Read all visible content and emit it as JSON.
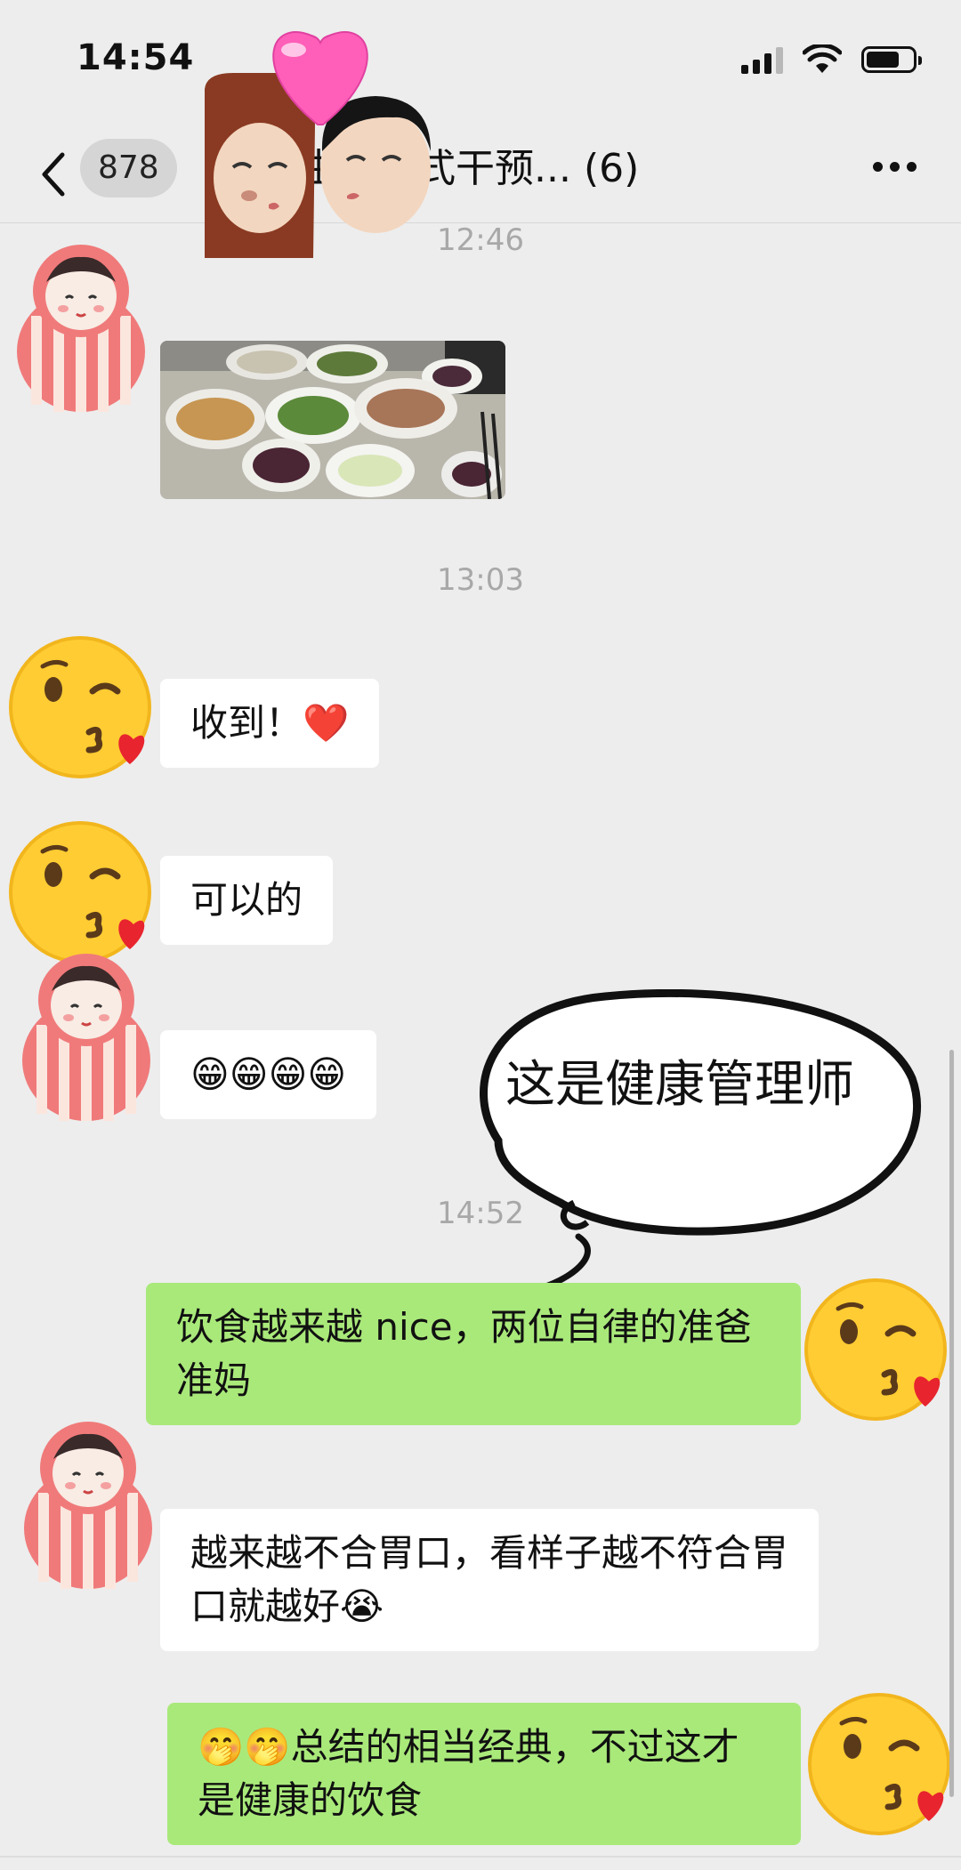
{
  "status_bar": {
    "time": "14:54"
  },
  "nav": {
    "unread_count": "878",
    "title": "生活方式干预... (6)"
  },
  "timestamps": [
    "12:46",
    "13:03",
    "14:52"
  ],
  "messages": [
    {
      "side": "in",
      "type": "image",
      "alt": "food-photo"
    },
    {
      "side": "in",
      "type": "text",
      "text": "收到！❤️"
    },
    {
      "side": "in",
      "type": "text",
      "text": "可以的"
    },
    {
      "side": "in",
      "type": "text",
      "text": "😁😁😁😁"
    },
    {
      "side": "out",
      "type": "text",
      "text": "饮食越来越 nice，两位自律的准爸准妈"
    },
    {
      "side": "in",
      "type": "text",
      "text": "越来越不合胃口，看样子越不符合胃口就越好😭"
    },
    {
      "side": "out",
      "type": "text",
      "text": "🤭🤭总结的相当经典，不过这才是健康的饮食"
    }
  ],
  "annotation": {
    "text": "这是健康管理师"
  },
  "colors": {
    "background": "#ededed",
    "outgoing_bubble": "#a9e97a",
    "incoming_bubble": "#ffffff"
  }
}
